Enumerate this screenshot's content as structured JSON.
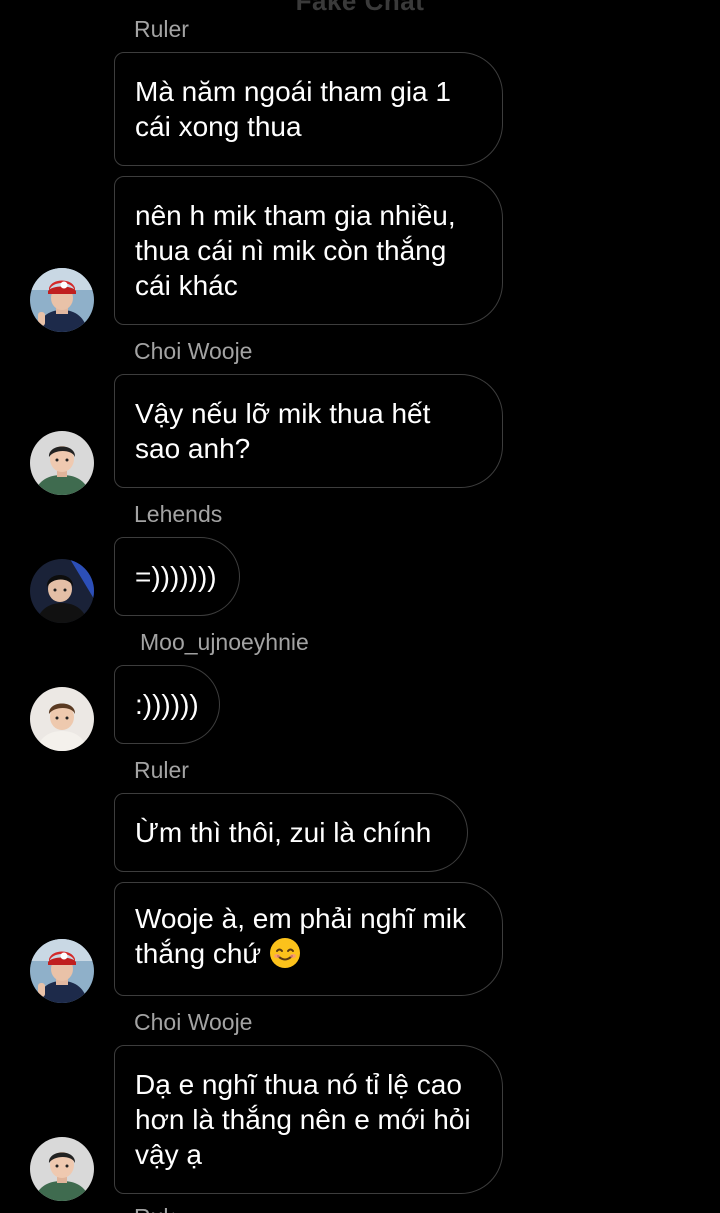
{
  "header": {
    "title": "Fake Chat"
  },
  "messages": [
    {
      "sender": "Ruler"
    },
    {
      "text": "Mà năm ngoái tham gia 1\ncái xong thua"
    },
    {
      "text": "nên h mik tham gia nhiều,\nthua cái nì mik còn thắng\ncái khác"
    },
    {
      "sender": "Choi Wooje"
    },
    {
      "text": "Vậy nếu lỡ mik thua hết\nsao anh?"
    },
    {
      "sender": "Lehends"
    },
    {
      "text": "=)))))))"
    },
    {
      "sender": "Moo_ujnoeyhnie"
    },
    {
      "text": ":))))))"
    },
    {
      "sender": "Ruler"
    },
    {
      "text": "Ừm thì thôi, zui là chính"
    },
    {
      "text": "Wooje à, em phải nghĩ mik\nthắng chứ",
      "emoji": "smiling-face-emoji"
    },
    {
      "sender": "Choi Wooje"
    },
    {
      "text": "Dạ e nghĩ thua nó tỉ lệ cao\nhơn là thắng nên e mới hỏi\nvậy ạ"
    },
    {
      "sender": "Ruler"
    }
  ],
  "avatars": [
    {
      "person": "Ruler",
      "icon": "avatar-ruler"
    },
    {
      "person": "Choi Wooje",
      "icon": "avatar-wooje"
    },
    {
      "person": "Lehends",
      "icon": "avatar-lehends"
    },
    {
      "person": "Moo_ujnoeyhnie",
      "icon": "avatar-moo"
    },
    {
      "person": "Ruler",
      "icon": "avatar-ruler"
    },
    {
      "person": "Choi Wooje",
      "icon": "avatar-wooje"
    }
  ],
  "colors": {
    "background": "#000000",
    "bubble_border": "#3d3d3d",
    "text": "#ffffff",
    "sender_name": "#a3a3a3"
  }
}
